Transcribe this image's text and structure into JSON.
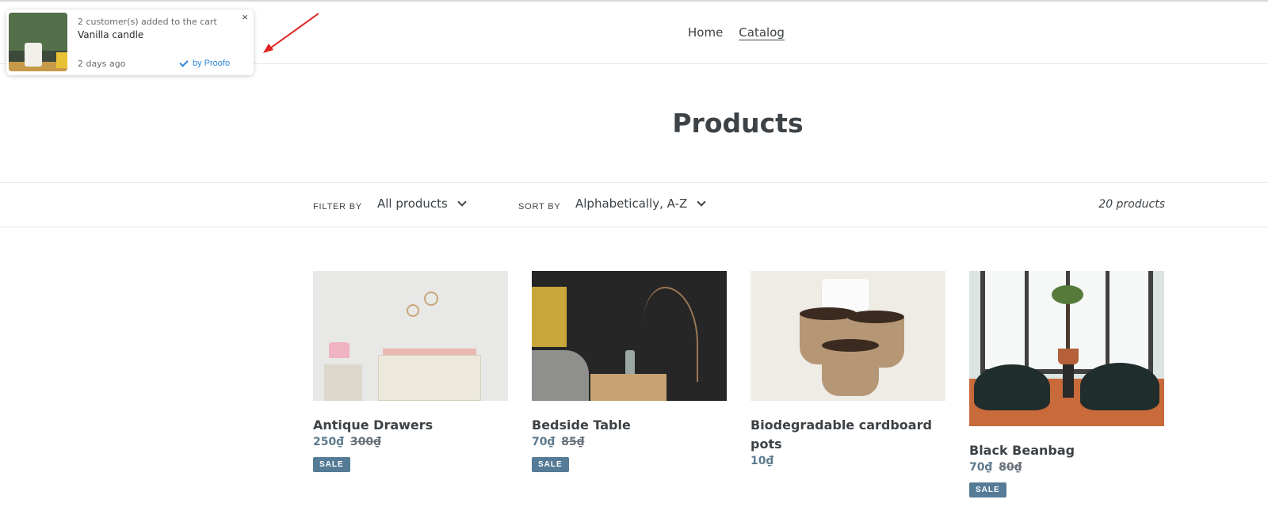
{
  "nav": {
    "home": "Home",
    "catalog": "Catalog"
  },
  "page": {
    "title": "Products"
  },
  "filter": {
    "filter_label": "FILTER BY",
    "filter_value": "All products",
    "sort_label": "SORT BY",
    "sort_value": "Alphabetically, A-Z",
    "count": "20 products"
  },
  "products": [
    {
      "name": "Antique Drawers",
      "price": "250₫",
      "compare_price": "300₫",
      "badge": "SALE"
    },
    {
      "name": "Bedside Table",
      "price": "70₫",
      "compare_price": "85₫",
      "badge": "SALE"
    },
    {
      "name": "Biodegradable cardboard pots",
      "price": "10₫"
    },
    {
      "name": "Black Beanbag",
      "price": "70₫",
      "compare_price": "80₫",
      "badge": "SALE"
    }
  ],
  "popup": {
    "line1": "2 customer(s) added to the cart",
    "product": "Vanilla candle",
    "time": "2 days ago",
    "brand": "by Proofo",
    "close": "×"
  },
  "colors": {
    "accent": "#557b97",
    "annotation_arrow": "#e02020",
    "popup_brand": "#2f86d8"
  }
}
